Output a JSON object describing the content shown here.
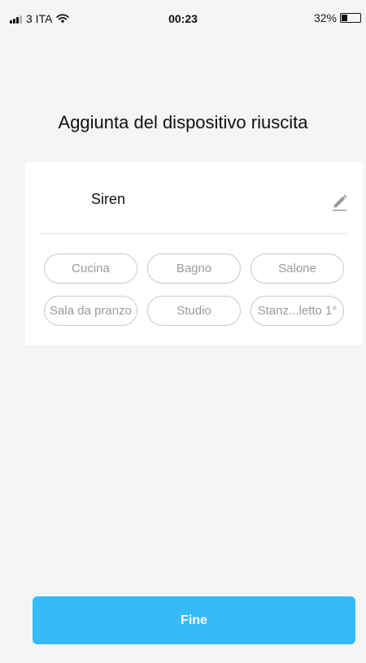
{
  "status_bar": {
    "carrier": "3 ITA",
    "time": "00:23",
    "battery": "32%",
    "battery_level": 0.32
  },
  "title": "Aggiunta del dispositivo riuscita",
  "device": {
    "name": "Siren",
    "edit_icon": "pencil-icon"
  },
  "rooms": [
    {
      "label": "Cucina"
    },
    {
      "label": "Bagno"
    },
    {
      "label": "Salone"
    },
    {
      "label": "Sala da pranzo"
    },
    {
      "label": "Studio"
    },
    {
      "label": "Stanz...letto 1°"
    }
  ],
  "done_button": {
    "label": "Fine",
    "color": "#35bcf8"
  }
}
